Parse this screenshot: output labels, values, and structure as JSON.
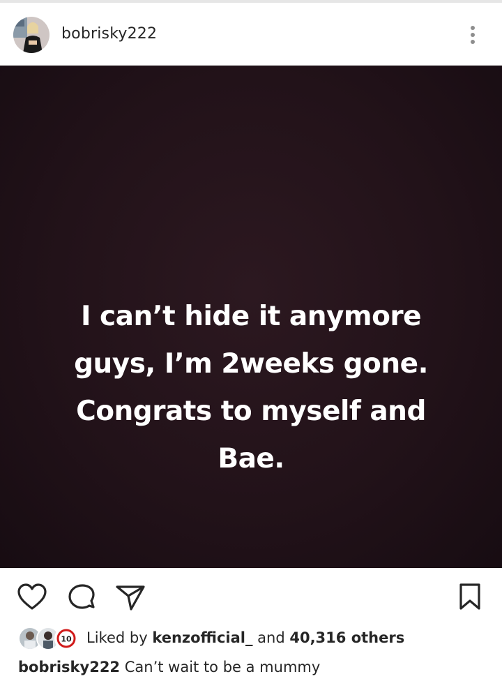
{
  "header": {
    "username": "bobrisky222"
  },
  "post": {
    "image_text": "I can’t hide it anymore\nguys, I’m 2weeks gone.\nCongrats to myself and\nBae."
  },
  "actions": {
    "like_icon": "heart-icon",
    "comment_icon": "comment-icon",
    "share_icon": "send-icon",
    "save_icon": "bookmark-icon"
  },
  "likes": {
    "prefix": "Liked by ",
    "first_liker": "kenzofficial_",
    "middle": " and ",
    "others": "40,316 others",
    "badge": "10"
  },
  "caption": {
    "username": "bobrisky222",
    "text": "Can’t wait to be a mummy"
  }
}
